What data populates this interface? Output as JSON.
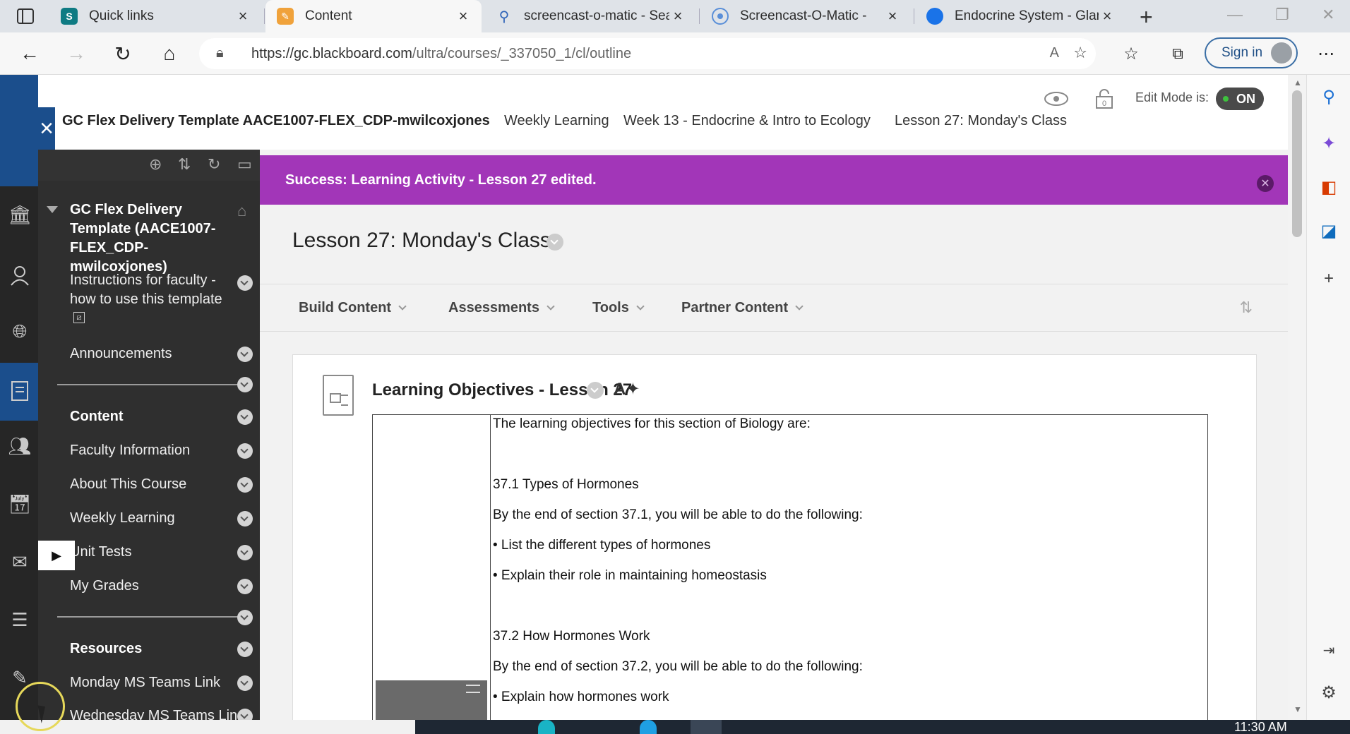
{
  "browser": {
    "tabs": [
      {
        "title": "Quick links",
        "favicon": "sharepoint-icon",
        "active": false
      },
      {
        "title": "Content",
        "favicon": "blackboard-icon",
        "active": true
      },
      {
        "title": "screencast-o-matic - Sear",
        "favicon": "search-icon",
        "active": false
      },
      {
        "title": "Screencast-O-Matic -",
        "favicon": "screencast-icon",
        "active": false
      },
      {
        "title": "Endocrine System - Gland",
        "favicon": "globe-icon",
        "active": false
      }
    ],
    "url_host": "https://gc.blackboard.com",
    "url_path": "/ultra/courses/_337050_1/cl/outline",
    "sign_in_label": "Sign in"
  },
  "header": {
    "course_title": "GC Flex Delivery Template AACE1007-FLEX_CDP-mwilcoxjones",
    "breadcrumbs": [
      "Weekly Learning",
      "Week 13 - Endocrine & Intro to Ecology",
      "Lesson 27: Monday's Class"
    ],
    "edit_mode_label": "Edit Mode is:",
    "edit_mode_value": "ON",
    "lock_count": "0"
  },
  "course_menu": {
    "course_name": "GC Flex Delivery Template (AACE1007-FLEX_CDP-mwilcoxjones)",
    "items": [
      {
        "label": "Instructions for faculty - how to use this template",
        "bold": false
      },
      {
        "label": "Announcements",
        "bold": false
      },
      {
        "label": "Content",
        "bold": true
      },
      {
        "label": "Faculty Information",
        "bold": false
      },
      {
        "label": "About This Course",
        "bold": false
      },
      {
        "label": "Weekly Learning",
        "bold": false
      },
      {
        "label": "Unit Tests",
        "bold": false
      },
      {
        "label": "My Grades",
        "bold": false
      },
      {
        "label": "Resources",
        "bold": true
      },
      {
        "label": "Monday MS Teams Link",
        "bold": false
      },
      {
        "label": "Wednesday MS Teams Link",
        "bold": false
      }
    ]
  },
  "banner": {
    "message": "Success: Learning Activity - Lesson 27 edited.",
    "color": "#a236b8"
  },
  "page": {
    "title": "Lesson 27: Monday's Class",
    "toolbar": [
      "Build Content",
      "Assessments",
      "Tools",
      "Partner Content"
    ]
  },
  "content_item": {
    "title": "Learning Objectives - Lesson 27",
    "lines": [
      "The learning objectives for this section of Biology are:",
      "",
      "37.1 Types of Hormones",
      "By the end of section 37.1, you will be able to do the following:",
      "• List the different types of hormones",
      "• Explain their role in maintaining homeostasis",
      "",
      "37.2 How Hormones Work",
      "By the end of section 37.2, you will be able to do the following:",
      "• Explain how hormones work"
    ]
  },
  "taskbar": {
    "clock": "11:30 AM"
  },
  "colors": {
    "accent_blue": "#1b4e8c",
    "menu_bg": "#2f2f2f",
    "banner_purple": "#a236b8"
  }
}
